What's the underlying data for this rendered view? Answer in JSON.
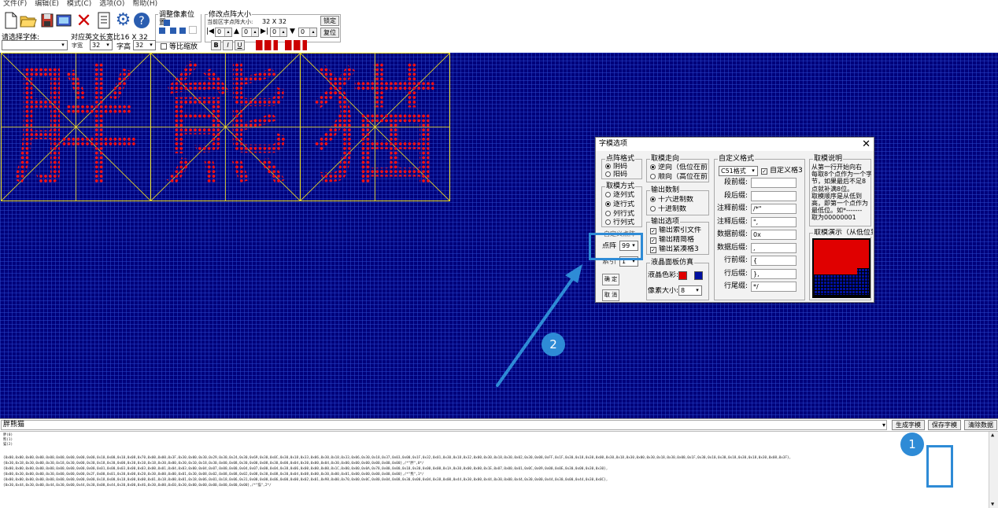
{
  "menu": [
    "文件(F)",
    "编辑(E)",
    "模式(C)",
    "选项(O)",
    "帮助(H)"
  ],
  "toolbar": {
    "font_label": "请选择字体:",
    "english_width_label": "对应英文长宽比16 X 32",
    "width_label": "字宽",
    "width_value": "32",
    "height_label": "字高",
    "height_value": "32",
    "proportional_label": "等比缩放",
    "adjust_group": "调整像素位置",
    "resize_group": "修改点阵大小",
    "resize_note": "当前区字点阵大小:",
    "resize_value": "32 X 32",
    "lock_button": "锁定",
    "reset_button": "复位",
    "field_values": [
      "0",
      "0",
      "0",
      "0",
      "0"
    ],
    "bold": "B",
    "italic": "I",
    "underline": "U"
  },
  "canvas": {
    "characters": [
      "胖",
      "熊",
      "猫"
    ],
    "colors": {
      "background": "#00007a",
      "pixel": "#ff1010",
      "frame": "#f0e020"
    }
  },
  "dialog": {
    "title": "字模选项",
    "dot_format": {
      "title": "点阵格式",
      "options": [
        "阴码",
        "阳码"
      ],
      "selected": 0
    },
    "take_mode": {
      "title": "取模方式",
      "options": [
        "逐列式",
        "逐行式",
        "列行式",
        "行列式"
      ],
      "selected": 1
    },
    "dot_label": "点阵",
    "dot_value": "99",
    "index_label": "索引",
    "index_value": "1",
    "confirm_button": "确 定",
    "cancel_button": "取 消",
    "direction": {
      "title": "取模走向",
      "options": [
        "逆向（低位在前",
        "顺向（高位在前"
      ],
      "selected": 0
    },
    "number_base": {
      "title": "输出数制",
      "options": [
        "十六进制数",
        "十进制数"
      ],
      "selected": 0
    },
    "output_options": {
      "title": "输出选项",
      "options": [
        "输出索引文件",
        "输出精简格",
        "输出紧凑格3"
      ]
    },
    "lcd": {
      "title": "液晶面板仿真",
      "color_label": "液晶色彩:",
      "pixel_size_label": "像素大小:",
      "pixel_size_value": "8",
      "colors": {
        "on": "#e00000",
        "off": "#0010a0"
      }
    },
    "custom": {
      "title": "自定义格式",
      "format_value": "C51格式",
      "custom_check": "自定义格3",
      "rows": [
        {
          "label": "段前缀:",
          "value": ""
        },
        {
          "label": "段后缀:",
          "value": ""
        },
        {
          "label": "注释前缀:",
          "value": "/*\""
        },
        {
          "label": "注释后缀:",
          "value": "\","
        },
        {
          "label": "数据前缀:",
          "value": "0x"
        },
        {
          "label": "数据后缀:",
          "value": ","
        },
        {
          "label": "行前缀:",
          "value": "{"
        },
        {
          "label": "行后缀:",
          "value": "},"
        },
        {
          "label": "行尾缀:",
          "value": "*/"
        }
      ]
    },
    "explain": {
      "title": "取模说明",
      "lines": [
        "从第一行开始向右",
        "每取8个点作为一个字",
        "节，如果最后不足8",
        "点就补满8位。",
        "取模顺序是从低到",
        "高，即第一个点作为",
        "最低位。如*-------",
        "取为00000001"
      ]
    },
    "demo_title": "取模演示（从低位到"
  },
  "bottom": {
    "combo_value": "胖熊猫",
    "generate_button": "生成字模",
    "save_button": "保存字模",
    "clear_button": "清除数据",
    "header_lines": [
      "胖(0)",
      "熊(1)",
      "猫(2)"
    ],
    "output_lines": [
      "{0x00,0x00,0x00,0x00,0x00,0x00,0x00,0x00,0x00,0x10,0x00,0x10,0x08,0x70,0x00,0x00,0x3F,0x30,0x00,0x30,0x29,0x30,0x24,0x30,0x69,0x30,0x0C,0x30,0x18,0x33,0x06,0x30,0x18,0x33,0x06,0x30,0x18,0x37,0x03,0x00,0x1F,0x32,0x01,0x30,0x18,0x32,0x00,0x30,0x18,0x30,0x02,0x30,0x08,0xFF,0x1F,0x30,0x18,0x30,0x00,0x30,0x18,0x30,0x00,0x30,0x18,0x30,0x00,0x1F,0x30,0x10,0x30,0x18,0x30,0x18,0x30,0x08,0x3F},",
      "{0x30,0x18,0x30,0x00,0x30,0x18,0x30,0x00,0x30,0x18,0x30,0x00,0x30,0x10,0x18,0x30,0x00,0x30,0x10,0x18,0x30,0x00,0x08,0x30,0x00,0x08,0x30,0x00,0x04,0x30,0x00,0x04,0x30,0x00,0x00,0x00,0x00,0x00,0x00},/*\"胖\",0*/",
      "{0x00,0x00,0x00,0x00,0x00,0x00,0x00,0x00,0x00,0x01,0x00,0x03,0x00,0x03,0x00,0x01,0x04,0x03,0x00,0x04,0x07,0x00,0x00,0x04,0x07,0x00,0x04,0x38,0x06,0x00,0x00,0x00,0x1C,0x00,0x00,0x0A,0x78,0x00,0x00,0x18,0x30,0x00,0x00,0x1A,0x30,0x00,0x00,0x1E,0x07,0x00,0x01,0x0C,0x09,0x00,0x0E,0x30,0x00,0x30,0x30},",
      "{0x00,0x30,0x00,0x00,0x30,0x00,0x00,0x00,0x2F,0x00,0x01,0x30,0x00,0x20,0x30,0x00,0x00,0x01,0x30,0x08,0x02,0x08,0x08,0x02,0x08,0x30,0x08,0x30,0x04,0x08,0x00,0x30,0x00,0x01,0x00,0x00,0x00,0x00,0x00},/*\"熊\",1*/",
      "{0x00,0x00,0x00,0x00,0x00,0x00,0x00,0x00,0x00,0x18,0x00,0x18,0x00,0x00,0x01,0x18,0x00,0x01,0x18,0x06,0x01,0x18,0x06,0x31,0x00,0x00,0x06,0x00,0x00,0x02,0x01,0x98,0x00,0x70,0x00,0x0C,0x80,0x04,0x08,0x30,0x00,0x04,0x38,0x00,0x44,0x30,0x00,0x44,0x30,0x00,0x44,0x30,0x00,0x44,0x30,0x00,0x44,0x30,0x0C},",
      "{0x30,0x44,0x30,0x00,0x44,0x30,0x00,0x44,0x30,0x00,0x44,0x30,0x00,0x46,0x30,0x00,0xE0,0x30,0x00,0x00,0x00,0x00,0x00,0x00},/*\"猫\",2*/"
    ]
  },
  "annotations": {
    "badge1": "1",
    "badge2": "2",
    "color": "#2e8bd6"
  }
}
